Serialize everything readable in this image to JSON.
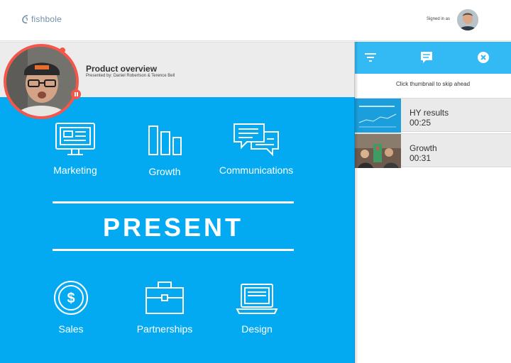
{
  "brand": {
    "logo_text": "fishbole",
    "accent": "#03aaf2",
    "record": "#f5564a"
  },
  "account": {
    "signed_in_label": "Signed in as"
  },
  "presentation": {
    "title": "Product overview",
    "presenters": "Presented by: Daniel Robertson & Terence Bell"
  },
  "slide": {
    "heading": "PRESENT",
    "top_items": [
      {
        "label": "Marketing",
        "icon": "monitor-icon"
      },
      {
        "label": "Growth",
        "icon": "bar-chart-icon"
      },
      {
        "label": "Communications",
        "icon": "chat-bubbles-icon"
      }
    ],
    "bottom_items": [
      {
        "label": "Sales",
        "icon": "dollar-coin-icon"
      },
      {
        "label": "Partnerships",
        "icon": "briefcase-icon"
      },
      {
        "label": "Design",
        "icon": "laptop-icon"
      }
    ]
  },
  "sidebar": {
    "toolbar": [
      {
        "icon": "filter-icon"
      },
      {
        "icon": "chat-icon"
      },
      {
        "icon": "close-icon"
      }
    ],
    "hint": "Click thumbnail to skip ahead",
    "thumbnails": [
      {
        "title": "HY results",
        "time": "00:25"
      },
      {
        "title": "Growth",
        "time": "00:31"
      }
    ]
  }
}
